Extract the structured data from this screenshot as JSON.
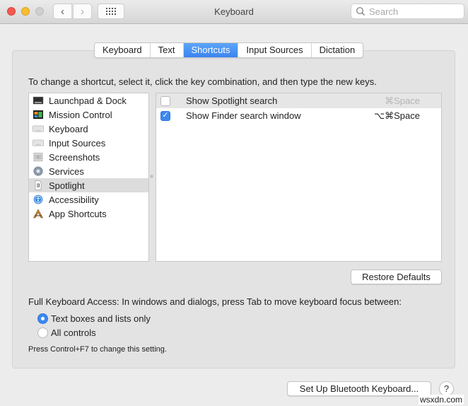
{
  "window": {
    "title": "Keyboard",
    "search_placeholder": "Search"
  },
  "tabs": [
    {
      "label": "Keyboard",
      "active": false
    },
    {
      "label": "Text",
      "active": false
    },
    {
      "label": "Shortcuts",
      "active": true
    },
    {
      "label": "Input Sources",
      "active": false
    },
    {
      "label": "Dictation",
      "active": false
    }
  ],
  "instruction": "To change a shortcut, select it, click the key combination, and then type the new keys.",
  "categories": [
    {
      "label": "Launchpad & Dock",
      "icon": "launchpad-dock-icon",
      "selected": false
    },
    {
      "label": "Mission Control",
      "icon": "mission-control-icon",
      "selected": false
    },
    {
      "label": "Keyboard",
      "icon": "keyboard-icon",
      "selected": false
    },
    {
      "label": "Input Sources",
      "icon": "input-sources-icon",
      "selected": false
    },
    {
      "label": "Screenshots",
      "icon": "screenshots-icon",
      "selected": false
    },
    {
      "label": "Services",
      "icon": "services-gear-icon",
      "selected": false
    },
    {
      "label": "Spotlight",
      "icon": "spotlight-document-icon",
      "selected": true
    },
    {
      "label": "Accessibility",
      "icon": "accessibility-icon",
      "selected": false
    },
    {
      "label": "App Shortcuts",
      "icon": "app-shortcuts-icon",
      "selected": false
    }
  ],
  "shortcuts": [
    {
      "label": "Show Spotlight search",
      "key": "⌘Space",
      "checked": false,
      "selected": true
    },
    {
      "label": "Show Finder search window",
      "key": "⌥⌘Space",
      "checked": true,
      "selected": false
    }
  ],
  "buttons": {
    "restore_defaults": "Restore Defaults",
    "setup_bluetooth": "Set Up Bluetooth Keyboard...",
    "help": "?"
  },
  "full_keyboard_access": {
    "label": "Full Keyboard Access: In windows and dialogs, press Tab to move keyboard focus between:",
    "options": [
      {
        "label": "Text boxes and lists only",
        "selected": true
      },
      {
        "label": "All controls",
        "selected": false
      }
    ],
    "hint": "Press Control+F7 to change this setting."
  },
  "watermark": "wsxdn.com",
  "colors": {
    "accent": "#3d87f0",
    "close": "#f25a51",
    "minimize": "#f8bd2e",
    "zoom_disabled": "#cfcfcf"
  }
}
